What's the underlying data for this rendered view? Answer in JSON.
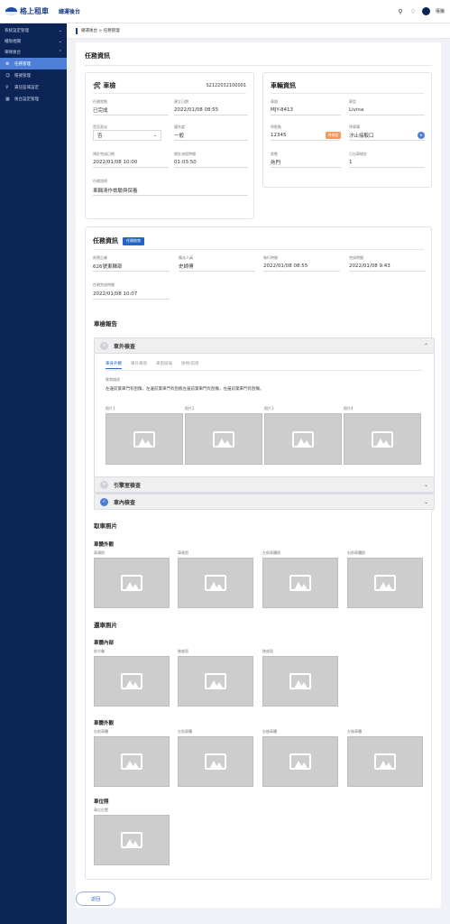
{
  "header": {
    "brand": "格上租車",
    "subtitle": "總運後台",
    "username": "權騰"
  },
  "sidebar": {
    "groups": [
      {
        "label": "系統設定管理"
      },
      {
        "label": "權限相關"
      },
      {
        "label": "車隊後台"
      }
    ],
    "items": [
      {
        "label": "任務管理",
        "icon": "gear-icon",
        "active": true
      },
      {
        "label": "帳號管理",
        "icon": "user-icon",
        "active": false
      },
      {
        "label": "責任區域設定",
        "icon": "location-icon",
        "active": false
      },
      {
        "label": "後台設定管理",
        "icon": "settings-icon",
        "active": false
      }
    ]
  },
  "breadcrumb": "總運後台 > 任務管理",
  "page_title": "任務資訊",
  "car_check": {
    "title": "車檢",
    "id": "S2122032100001",
    "fields": [
      {
        "label": "任務狀態",
        "value": "已完成"
      },
      {
        "label": "建立日期",
        "value": "2022/01/08 08:55"
      },
      {
        "label": "是否直派",
        "value": "否"
      },
      {
        "label": "優先度",
        "value": "一般"
      },
      {
        "label": "預計完成日期",
        "value": "2022/01/08 10:00"
      },
      {
        "label": "總計流程時間",
        "value": "01:03:50"
      },
      {
        "label": "任務說明",
        "value": "車輛清作檢驗與保養"
      }
    ]
  },
  "vehicle": {
    "title": "車輛資訊",
    "fields": [
      {
        "label": "車號",
        "value": "MJY-8413"
      },
      {
        "label": "車型",
        "value": "Livina"
      },
      {
        "label": "停駐點",
        "value": "12345"
      },
      {
        "label": "停車場",
        "value": "汐止接駁口"
      },
      {
        "label": "狀態",
        "value": "熱門"
      },
      {
        "label": "已出車統計",
        "value": "1"
      }
    ],
    "badge": "待排程"
  },
  "task_info": {
    "title": "任務資訊",
    "tag": "任務結束",
    "fields": [
      {
        "label": "負責企業",
        "value": "626號東驛部"
      },
      {
        "label": "備派人員",
        "value": "史師傅"
      },
      {
        "label": "執行時間",
        "value": "2022/01/08 08:55"
      },
      {
        "label": "完成時間",
        "value": "2022/01/08 9:43"
      },
      {
        "label": "任務完成時間",
        "value": "2022/01/08 10:07"
      }
    ]
  },
  "inspection": {
    "title": "車檢報告",
    "sections": [
      {
        "label": "車外檢查",
        "done": false,
        "expanded": true
      },
      {
        "label": "引擎室檢查",
        "done": false,
        "expanded": false
      },
      {
        "label": "車內檢查",
        "done": true,
        "expanded": false
      }
    ],
    "tabs": [
      "車身外觀",
      "車外車燈",
      "車窗玻璃",
      "後視/前燈"
    ],
    "note_label": "異常描述",
    "note": "左邊前葉車門有刮傷，左邊前葉車門有刮痕左邊前葉車門有刮傷，左邊前葉車門有刮傷。",
    "photos": [
      "照片1",
      "照片2",
      "照片3",
      "照片4"
    ]
  },
  "pickup_photos": {
    "title": "取車照片",
    "sub": "車體外觀",
    "labels": [
      "車頭照",
      "車尾照",
      "左前車體照",
      "右前車體照"
    ]
  },
  "return_photos": {
    "title": "還車照片",
    "interior": {
      "sub": "車體內部",
      "labels": [
        "前方儀",
        "後座面",
        "後座面"
      ]
    },
    "exterior": {
      "sub": "車體外觀",
      "labels": [
        "右前車體",
        "左前車體",
        "右後車體",
        "左後車體"
      ]
    },
    "parking": {
      "sub": "車位照",
      "labels": [
        "車位位置"
      ]
    }
  },
  "back_button": "返回"
}
